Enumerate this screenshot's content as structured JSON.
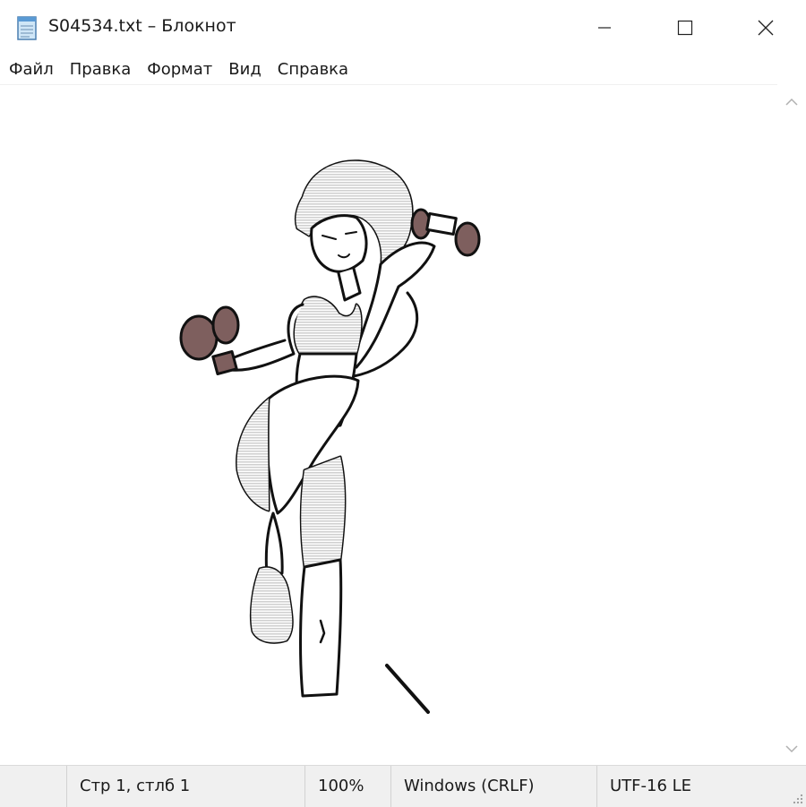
{
  "window": {
    "title": "S04534.txt – Блокнот",
    "icon": "notepad-icon"
  },
  "caption_buttons": {
    "minimize_icon": "minimize-icon",
    "maximize_icon": "maximize-icon",
    "close_icon": "close-icon"
  },
  "menu": {
    "items": [
      "Файл",
      "Правка",
      "Формат",
      "Вид",
      "Справка"
    ]
  },
  "editor": {
    "content_description_icon": "ascii-art-woman-lifting-dumbbells"
  },
  "scrollbar": {
    "up_icon": "chevron-up-icon",
    "down_icon": "chevron-down-icon"
  },
  "status": {
    "position": "Стр 1, стлб 1",
    "zoom": "100%",
    "line_endings": "Windows (CRLF)",
    "encoding": "UTF-16 LE"
  },
  "colors": {
    "hair": "#c9c2a8",
    "top": "#caa7a0",
    "shorts": "#8a9aae",
    "dumbbell": "#7e5f5e",
    "shoe": "#a39b8c",
    "outline": "#111111"
  }
}
